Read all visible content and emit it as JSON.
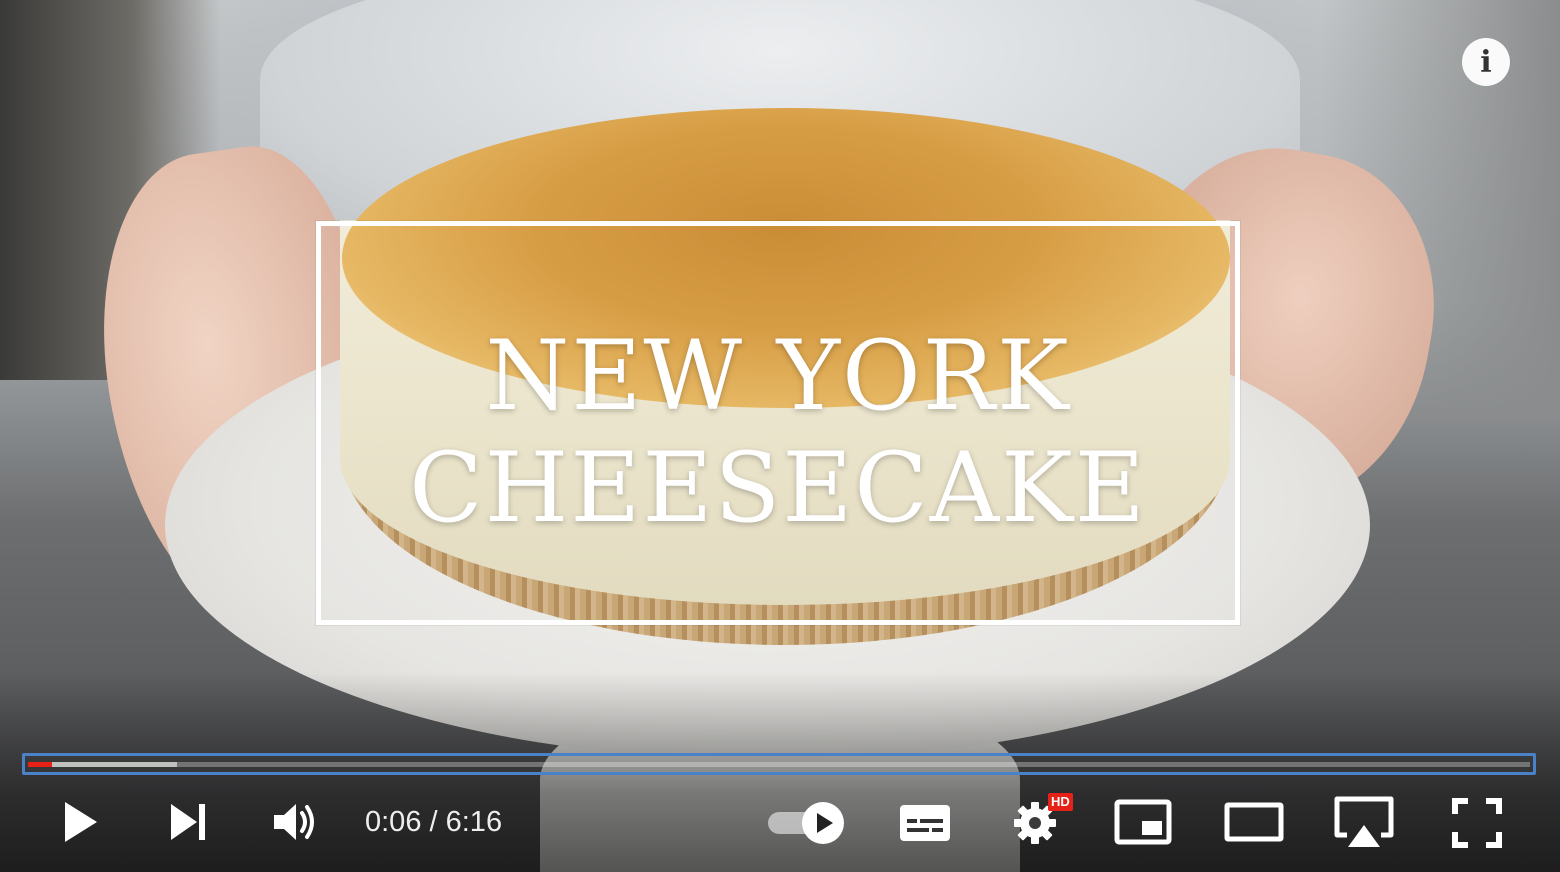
{
  "video": {
    "title_line_1": "NEW YORK",
    "title_line_2": "CHEESECAKE"
  },
  "info_button": {
    "icon": "info-icon",
    "label": "i"
  },
  "progress": {
    "played_fraction": 0.016,
    "buffered_fraction": 0.099,
    "played_color": "#e62117",
    "highlight_color": "#4a82c8"
  },
  "controls": {
    "current_time": "0:06",
    "separator": " / ",
    "duration": "6:16",
    "play_icon": "play-icon",
    "next_icon": "next-icon",
    "volume_icon": "volume-icon",
    "autoplay_toggle_icon": "autoplay-toggle-icon",
    "subtitles_icon": "subtitles-icon",
    "settings_icon": "gear-icon",
    "hd_badge": "HD",
    "miniplayer_icon": "miniplayer-icon",
    "theater_icon": "theater-mode-icon",
    "airplay_icon": "airplay-icon",
    "fullscreen_icon": "fullscreen-icon"
  }
}
